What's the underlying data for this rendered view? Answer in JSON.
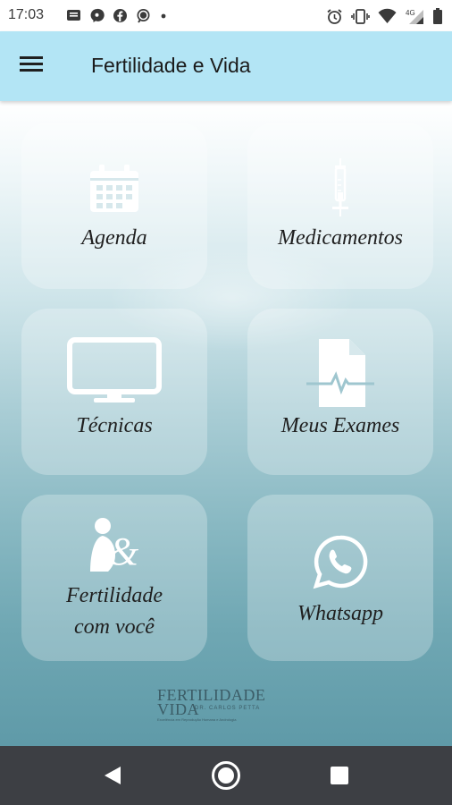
{
  "status_bar": {
    "time": "17:03",
    "left_icons": [
      "message-icon",
      "chat-bubble-icon",
      "facebook-icon",
      "messenger-icon",
      "dot-icon"
    ],
    "right_icons": [
      "alarm-icon",
      "vibrate-icon",
      "wifi-icon",
      "signal-4g-icon",
      "battery-icon"
    ],
    "network": "4G"
  },
  "app_bar": {
    "title": "Fertilidade e Vida",
    "menu_icon": "hamburger-menu-icon",
    "background": "#b3e5f5"
  },
  "tiles": [
    {
      "label": "Agenda",
      "icon": "calendar-icon"
    },
    {
      "label": "Medicamentos",
      "icon": "syringe-icon"
    },
    {
      "label": "Técnicas",
      "icon": "monitor-icon"
    },
    {
      "label": "Meus Exames",
      "icon": "medical-document-icon"
    },
    {
      "label_line1": "Fertilidade",
      "label_line2": "com você",
      "icon": "pregnancy-ampersand-icon"
    },
    {
      "label": "Whatsapp",
      "icon": "whatsapp-icon"
    }
  ],
  "footer_logo": {
    "line1": "FERTILIDADE",
    "line2": "VIDA",
    "line3": "DR. CARLOS PETTA",
    "line4": "Excelência em Reprodução Humana e Andrologia"
  },
  "nav_bar": {
    "back_icon": "back-triangle-icon",
    "home_icon": "home-circle-icon",
    "recents_icon": "recents-square-icon"
  }
}
